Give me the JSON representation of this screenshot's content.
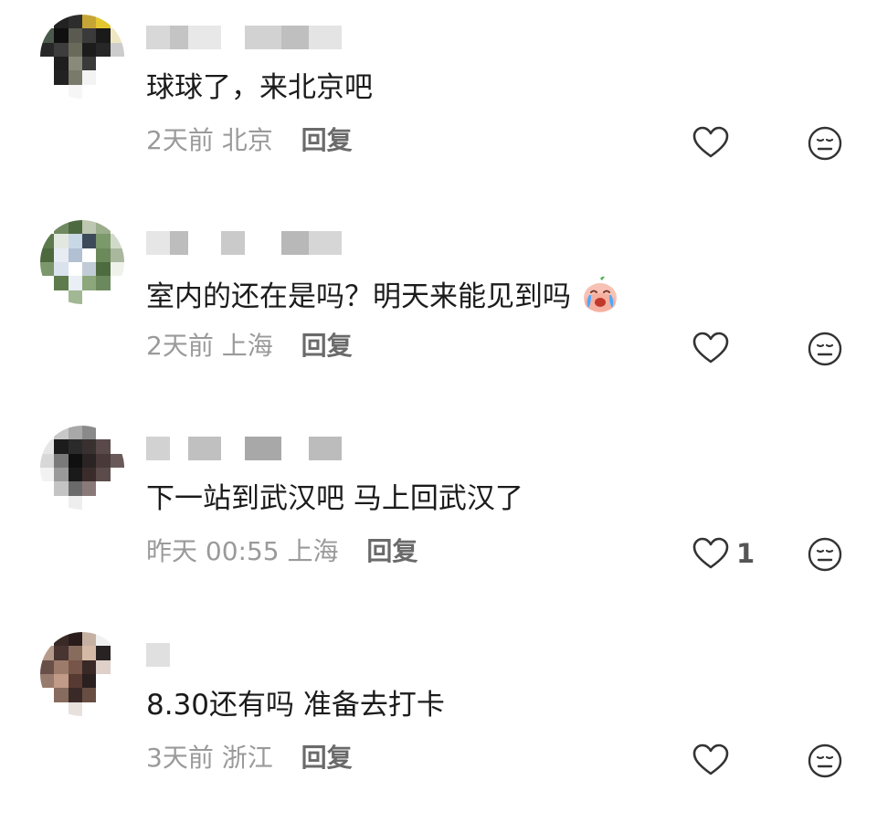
{
  "comments": [
    {
      "text": "球球了，来北京吧",
      "time": "2天前",
      "location": "北京",
      "reply_label": "回复",
      "like_count": "",
      "avatar_colors": [
        "#f4f4f4",
        "#222222",
        "#2d2d2d",
        "#c9a52a",
        "#e8c820",
        "#ffffff",
        "#4a5a4c",
        "#101010",
        "#5a5a50",
        "#3a3a3a",
        "#1a1a1a",
        "#f0e7c0",
        "#282828",
        "#3d3d3d",
        "#6a6a5a",
        "#1c1c1c",
        "#272727",
        "#cccccc",
        "#ffffff",
        "#1e1e1e",
        "#8a8a7a",
        "#3a3a3a",
        "#ffffff",
        "#ffffff",
        "#ffffff",
        "#222222",
        "#7a7a6a",
        "#f3f3f3",
        "#ffffff",
        "#ffffff",
        "#ffffff",
        "#ffffff",
        "#f6f6f6",
        "#ffffff",
        "#ffffff",
        "#ffffff"
      ],
      "username_colors": [
        "#d8d8d8",
        "#c4c4c4",
        "#e8e8e8",
        "#ffffff",
        "#d2d2d2",
        "#bfbfbf",
        "#e4e4e4"
      ]
    },
    {
      "text": "室内的还在是吗？明天来能见到吗",
      "emoji": "crying-face-emoji",
      "time": "2天前",
      "location": "上海",
      "reply_label": "回复",
      "like_count": "",
      "avatar_colors": [
        "#ffffff",
        "#6e8a5a",
        "#4a6a3c",
        "#bcc7b0",
        "#9aae88",
        "#ffffff",
        "#5a7a48",
        "#e2e8de",
        "#c8d8e8",
        "#3c4a5c",
        "#7a9a68",
        "#d0dac8",
        "#4a6a3a",
        "#e6ecf4",
        "#b0c0d4",
        "#ffffff",
        "#6a8a58",
        "#a8b89a",
        "#7a9868",
        "#d8e2ee",
        "#ffffff",
        "#c0ccd8",
        "#4c6c3c",
        "#eef2ea",
        "#ffffff",
        "#5c7c4a",
        "#eaeef6",
        "#8aa878",
        "#6a8a5a",
        "#ffffff",
        "#ffffff",
        "#ffffff",
        "#a0b890",
        "#ffffff",
        "#ffffff",
        "#ffffff"
      ],
      "username_colors": [
        "#e6e6e6",
        "#bdbdbd",
        "#ffffff",
        "#cacaca",
        "#ffffff",
        "#b8b8b8",
        "#d6d6d6"
      ]
    },
    {
      "text": "下一站到武汉吧 马上回武汉了",
      "time": "昨天 00:55",
      "location": "上海",
      "reply_label": "回复",
      "like_count": "1",
      "avatar_colors": [
        "#ffffff",
        "#c8c8c8",
        "#a8a8a8",
        "#8a8a8a",
        "#ffffff",
        "#ffffff",
        "#e6e6e6",
        "#1c1c1c",
        "#2a2a2a",
        "#3a3030",
        "#5a4a48",
        "#ffffff",
        "#d8d8d8",
        "#7a7a7a",
        "#101010",
        "#2c2424",
        "#4a3a38",
        "#6a5a58",
        "#f2f2f2",
        "#9a9a9a",
        "#1a1a1a",
        "#3c2c2c",
        "#5c4c4a",
        "#ffffff",
        "#ffffff",
        "#c4c4c4",
        "#6a6a6a",
        "#8a7a78",
        "#ffffff",
        "#ffffff",
        "#ffffff",
        "#ffffff",
        "#eeeeee",
        "#ffffff",
        "#ffffff",
        "#ffffff"
      ],
      "username_colors": [
        "#d2d2d2",
        "#ffffff",
        "#c0c0c0",
        "#ffffff",
        "#a8a8a8",
        "#ffffff",
        "#bcbcbc"
      ]
    },
    {
      "text": "8.30还有吗 准备去打卡",
      "time": "3天前",
      "location": "浙江",
      "reply_label": "回复",
      "like_count": "",
      "avatar_colors": [
        "#ffffff",
        "#3a2a26",
        "#2a1c1a",
        "#c8b0a0",
        "#f0f0f0",
        "#ffffff",
        "#b89a8a",
        "#4a3430",
        "#8a6a5a",
        "#d8b8a4",
        "#2a2222",
        "#ffffff",
        "#6a5048",
        "#a07a68",
        "#7a5446",
        "#3a2824",
        "#e0d0c8",
        "#ffffff",
        "#9a7a6a",
        "#c49a84",
        "#5a3a30",
        "#2c2020",
        "#ffffff",
        "#ffffff",
        "#ffffff",
        "#8a6a5c",
        "#3a2a26",
        "#6a4c40",
        "#ffffff",
        "#ffffff",
        "#ffffff",
        "#ffffff",
        "#e8e0dc",
        "#ffffff",
        "#ffffff",
        "#ffffff"
      ],
      "username_colors": [
        "#e0e0e0",
        "#ffffff",
        "#ffffff",
        "#ffffff",
        "#ffffff",
        "#ffffff",
        "#ffffff"
      ]
    }
  ],
  "colors": {
    "text": "#1b1b1b",
    "meta": "#9a9a9a",
    "reply": "#6a6a6a",
    "icon": "#333333"
  },
  "icons": {
    "like": "heart-outline-icon",
    "react": "neutral-face-icon"
  }
}
